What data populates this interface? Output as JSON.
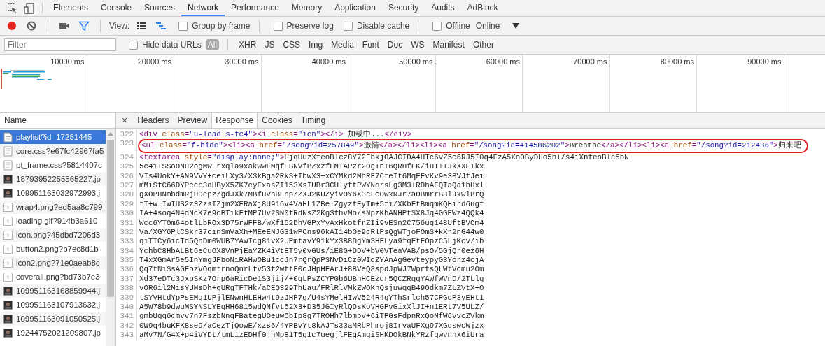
{
  "devtools_tabs": [
    {
      "label": "Elements",
      "selected": false
    },
    {
      "label": "Console",
      "selected": false
    },
    {
      "label": "Sources",
      "selected": false
    },
    {
      "label": "Network",
      "selected": true
    },
    {
      "label": "Performance",
      "selected": false
    },
    {
      "label": "Memory",
      "selected": false
    },
    {
      "label": "Application",
      "selected": false
    },
    {
      "label": "Security",
      "selected": false
    },
    {
      "label": "Audits",
      "selected": false
    },
    {
      "label": "AdBlock",
      "selected": false
    }
  ],
  "toolbar": {
    "recording": true,
    "view_label": "View:",
    "options": [
      {
        "label": "Group by frame",
        "checked": false
      },
      {
        "label": "Preserve log",
        "checked": false
      },
      {
        "label": "Disable cache",
        "checked": false
      },
      {
        "label": "Offline",
        "checked": false
      }
    ],
    "throttle": "Online"
  },
  "filter": {
    "placeholder": "Filter",
    "hide_data_urls": {
      "label": "Hide data URLs",
      "checked": false
    },
    "types": [
      {
        "label": "All",
        "selected": true
      },
      {
        "label": "XHR",
        "selected": false
      },
      {
        "label": "JS",
        "selected": false
      },
      {
        "label": "CSS",
        "selected": false
      },
      {
        "label": "Img",
        "selected": false
      },
      {
        "label": "Media",
        "selected": false
      },
      {
        "label": "Font",
        "selected": false
      },
      {
        "label": "Doc",
        "selected": false
      },
      {
        "label": "WS",
        "selected": false
      },
      {
        "label": "Manifest",
        "selected": false
      },
      {
        "label": "Other",
        "selected": false
      }
    ]
  },
  "overview": {
    "ticks": [
      "10000 ms",
      "20000 ms",
      "30000 ms",
      "40000 ms",
      "50000 ms",
      "60000 ms",
      "70000 ms",
      "80000 ms",
      "90000 ms"
    ]
  },
  "requests": {
    "column": "Name",
    "items": [
      {
        "name": "playlist?id=17281445",
        "kind": "document",
        "selected": true
      },
      {
        "name": "core.css?e67fc42967fa5",
        "kind": "stylesheet",
        "selected": false
      },
      {
        "name": "pt_frame.css?5814407c",
        "kind": "stylesheet",
        "selected": false
      },
      {
        "name": "18793952255565227.jp",
        "kind": "photo",
        "selected": false
      },
      {
        "name": "109951163032972993.j",
        "kind": "photo",
        "selected": false
      },
      {
        "name": "wrap4.png?ed5aa8c799",
        "kind": "graphic",
        "selected": false
      },
      {
        "name": "loading.gif?914b3a610",
        "kind": "graphic",
        "selected": false
      },
      {
        "name": "icon.png?45dbd7206d3",
        "kind": "graphic",
        "selected": false
      },
      {
        "name": "button2.png?b7ec8d1b",
        "kind": "graphic",
        "selected": false
      },
      {
        "name": "icon2.png?71e0aeab8c",
        "kind": "graphic",
        "selected": false
      },
      {
        "name": "coverall.png?bd73b7e3",
        "kind": "graphic",
        "selected": false
      },
      {
        "name": "109951163168859944.j",
        "kind": "photo",
        "selected": false
      },
      {
        "name": "109951163107913632.j",
        "kind": "photo",
        "selected": false
      },
      {
        "name": "109951163091050525.j",
        "kind": "photo",
        "selected": false
      },
      {
        "name": "19244752021209807.jp",
        "kind": "photo",
        "selected": false
      }
    ]
  },
  "detail": {
    "close": "×",
    "tabs": [
      {
        "label": "Headers",
        "selected": false
      },
      {
        "label": "Preview",
        "selected": false
      },
      {
        "label": "Response",
        "selected": true
      },
      {
        "label": "Cookies",
        "selected": false
      },
      {
        "label": "Timing",
        "selected": false
      }
    ],
    "lines": [
      {
        "number": "322",
        "highlighted": false,
        "segments": [
          {
            "kind": "tag",
            "text": "<div"
          },
          {
            "kind": "attr",
            "text": " class"
          },
          {
            "kind": "tag",
            "text": "="
          },
          {
            "kind": "value",
            "text": "\"u-load s-fc4\""
          },
          {
            "kind": "tag",
            "text": "><i"
          },
          {
            "kind": "attr",
            "text": " class"
          },
          {
            "kind": "tag",
            "text": "="
          },
          {
            "kind": "value",
            "text": "\"icn\""
          },
          {
            "kind": "tag",
            "text": "></i>"
          },
          {
            "kind": "text",
            "text": " 加载中..."
          },
          {
            "kind": "tag",
            "text": "</div>"
          }
        ]
      },
      {
        "number": "323",
        "highlighted": true,
        "segments": [
          {
            "kind": "tag",
            "text": "<ul"
          },
          {
            "kind": "attr",
            "text": " class"
          },
          {
            "kind": "tag",
            "text": "="
          },
          {
            "kind": "value",
            "text": "\"f-hide\""
          },
          {
            "kind": "tag",
            "text": "><li><a"
          },
          {
            "kind": "attr",
            "text": " href"
          },
          {
            "kind": "tag",
            "text": "="
          },
          {
            "kind": "value",
            "text": "\"/song?id=257849\""
          },
          {
            "kind": "tag",
            "text": ">"
          },
          {
            "kind": "text",
            "text": "激情"
          },
          {
            "kind": "tag",
            "text": "</a></li><li><a"
          },
          {
            "kind": "attr",
            "text": " href"
          },
          {
            "kind": "tag",
            "text": "="
          },
          {
            "kind": "value",
            "text": "\"/song?id=414586202\""
          },
          {
            "kind": "tag",
            "text": ">"
          },
          {
            "kind": "text",
            "text": "Breathe"
          },
          {
            "kind": "tag",
            "text": "</a></li><li><a"
          },
          {
            "kind": "attr",
            "text": " href"
          },
          {
            "kind": "tag",
            "text": "="
          },
          {
            "kind": "value",
            "text": "\"/song?id=212436\""
          },
          {
            "kind": "tag",
            "text": ">"
          },
          {
            "kind": "text",
            "text": "归来吧"
          }
        ]
      },
      {
        "number": "324",
        "highlighted": false,
        "segments": [
          {
            "kind": "tag",
            "text": "<textarea"
          },
          {
            "kind": "attr",
            "text": " style"
          },
          {
            "kind": "tag",
            "text": "="
          },
          {
            "kind": "value",
            "text": "\"display:none;\""
          },
          {
            "kind": "tag",
            "text": ">"
          },
          {
            "kind": "text",
            "text": "HjqUuzXfeoBlcz8Y72FbkjOAJCIDA4HTc6vZ5c6RJ5I0q4FzA5XoOByDHo5b+/s4iXnfeoBlc5bN"
          }
        ]
      },
      {
        "number": "325",
        "highlighted": false,
        "segments": [
          {
            "kind": "text",
            "text": "5c41TSSoONu2ogMwLrxqla9xakwwFMqfEBNVfPZxzfEN+APzr2OgTn+6QRHfFK/iuI+IJkXXEIkx"
          }
        ]
      },
      {
        "number": "326",
        "highlighted": false,
        "segments": [
          {
            "kind": "text",
            "text": "VIs4UokY+AN9VVY+ceiLXy3/X3kBga2RkS+IbwX3+xCYMkd2MhRF7CteIt6MqFFvKv9e3BVJfJei"
          }
        ]
      },
      {
        "number": "327",
        "highlighted": false,
        "segments": [
          {
            "kind": "text",
            "text": "mMiSfC66DYPecc3dHByX5ZK7cyExasZI153XsIUBr3CUlyftPWYNorsLg3M3+RDhAFQTaQa1bHxl"
          }
        ]
      },
      {
        "number": "328",
        "highlighted": false,
        "segments": [
          {
            "kind": "text",
            "text": "gXOP8NmbdmRjUDepz/gdJXk7MBfuVhBFnp/ZXJ2KUZyiVOY6X3cLcOWxRJr7aOBmrrB8lJxwlBrQ"
          }
        ]
      },
      {
        "number": "329",
        "highlighted": false,
        "segments": [
          {
            "kind": "text",
            "text": "tT+wlIwIUS2z3ZzsIZjm2XERaXj8U916v4VaHL1ZBelZgyzfEyTm+5ti/XKbFtBmqmKQHird6ugf"
          }
        ]
      },
      {
        "number": "330",
        "highlighted": false,
        "segments": [
          {
            "kind": "text",
            "text": "IA+4soq4N4dNcK7e9cBTikFfMP7Uv2SN0fRdNsZ2Kg3fhvMo/sNpzKhANHPtSX8Jq4GGEWz4QQk4"
          }
        ]
      },
      {
        "number": "331",
        "highlighted": false,
        "segments": [
          {
            "kind": "text",
            "text": "Wcc6YTOm64otlLbROx3D75rWFFB/wXf152DhVGPxYyAxHkotfrZIi9vESn2C756uq148UftBVCm4"
          }
        ]
      },
      {
        "number": "332",
        "highlighted": false,
        "segments": [
          {
            "kind": "text",
            "text": "Va/XGY6PlCSkr37oinSmVaXh+MEeENJG31wPCns96kAI14bOe9cRlPsQgWTjoFOmS+kXr2nG44w0"
          }
        ]
      },
      {
        "number": "333",
        "highlighted": false,
        "segments": [
          {
            "kind": "text",
            "text": "qiTTCy6icTd5QnDm0WUB7YAwIcg81vX2UPmtavY91kYx3B8DgYmSHFLya9fqFtFOpzC5LjKcv/ib"
          }
        ]
      },
      {
        "number": "334",
        "highlighted": false,
        "segments": [
          {
            "kind": "text",
            "text": "YchbC8HbALBt6eCuOX8VnPjEaYZK4iVtET5y0vGUs/iE8G+DDV+bV0VTeaVAB/psO/5GjQr0ez6H"
          }
        ]
      },
      {
        "number": "335",
        "highlighted": false,
        "segments": [
          {
            "kind": "text",
            "text": "T4xXGmAr5e5InYmgJPboNiRAHwOBu1ccJn7rQrQpP3NvDiCz0WIcZYAnAgGevteypyG3Yorz4cjA"
          }
        ]
      },
      {
        "number": "336",
        "highlighted": false,
        "segments": [
          {
            "kind": "text",
            "text": "Qq7tNiSsAGFozVOqmtrnoQnrLfv53f2wftF0oJHpHFArJ+8BVeQ8spdJpWJ7WprfsQLWtVcmu2Om"
          }
        ]
      },
      {
        "number": "337",
        "highlighted": false,
        "segments": [
          {
            "kind": "text",
            "text": "Xd37eDTc3JxpSKz7Orp6aRicDe1S3jij/+0qLPsZCYP0b6UBnHCEzqr5QCZRqqYAWfWVnD/2TLlq"
          }
        ]
      },
      {
        "number": "338",
        "highlighted": false,
        "segments": [
          {
            "kind": "text",
            "text": "vOR6il2MisYUMsDh+gURgTFTHk/aCEQ329ThUau/FRlRlVMkZWOKhQsjuwqqB49Odkm7ZLZVtX+O"
          }
        ]
      },
      {
        "number": "339",
        "highlighted": false,
        "segments": [
          {
            "kind": "text",
            "text": "tSYVHtdYpPsEMq1UPjlENwnHLEHw4t9zJHP7g/U4sYMelHIwV524R4qYThSrlch57CPGdP3yEHt1"
          }
        ]
      },
      {
        "number": "340",
        "highlighted": false,
        "segments": [
          {
            "kind": "text",
            "text": "A5W78b9dwuMSYNSLYEqHH6815wdQNfvt52X3+D35JGIyRlQDsKoVHGPvGixXlJI+n1ERt7V5ULZ/"
          }
        ]
      },
      {
        "number": "341",
        "highlighted": false,
        "segments": [
          {
            "kind": "text",
            "text": "gmbUqq6cmvv7n7FszbNnqFBategUOeuwObIp8g7TROHh7lbmpv+6iTPGsFdpnRxQoMfW6vvcZVkm"
          }
        ]
      },
      {
        "number": "342",
        "highlighted": false,
        "segments": [
          {
            "kind": "text",
            "text": "0W9q4buKFK8se9/aCezTjQowE/xzs6/4YPBvYt8kAJTs33aMRbPhmoj8IrvaUFXg97XGqswcWjzx"
          }
        ]
      },
      {
        "number": "343",
        "highlighted": false,
        "segments": [
          {
            "kind": "text",
            "text": "aMv7N/G4X+p4iVYDt/tmL1zEDHf0jhMpB1T5g1c7uegjlFEgAmqiSHKDOkBNkYRzfqwvnnx6iUra"
          }
        ]
      }
    ]
  }
}
